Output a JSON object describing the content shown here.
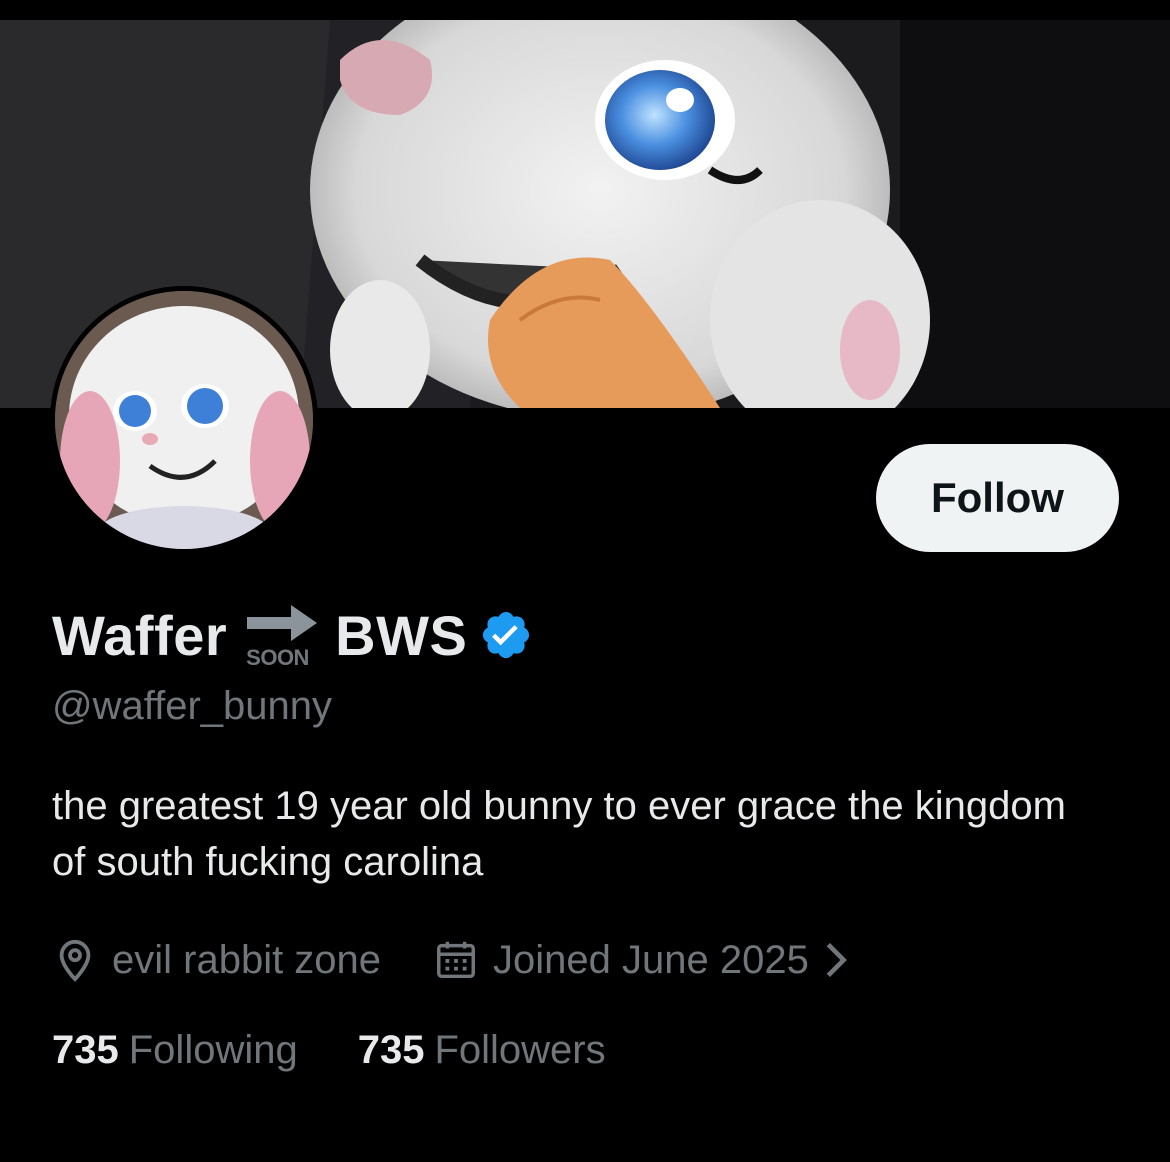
{
  "profile": {
    "name_part1": "Waffer",
    "soon_label": "SOON",
    "name_part2": "BWS",
    "handle": "@waffer_bunny",
    "bio": "the greatest 19 year old bunny to ever grace the kingdom of south fucking carolina",
    "location": "evil rabbit zone",
    "joined": "Joined June 2025",
    "verified_color": "#1d9bf0"
  },
  "actions": {
    "follow_label": "Follow"
  },
  "stats": {
    "following_count": "735",
    "following_label": "Following",
    "followers_count": "735",
    "followers_label": "Followers"
  },
  "icons": {
    "verified": "verified-badge-icon",
    "location": "location-pin-icon",
    "calendar": "calendar-icon",
    "chevron": "chevron-right-icon",
    "soon_arrow": "soon-arrow-icon"
  }
}
